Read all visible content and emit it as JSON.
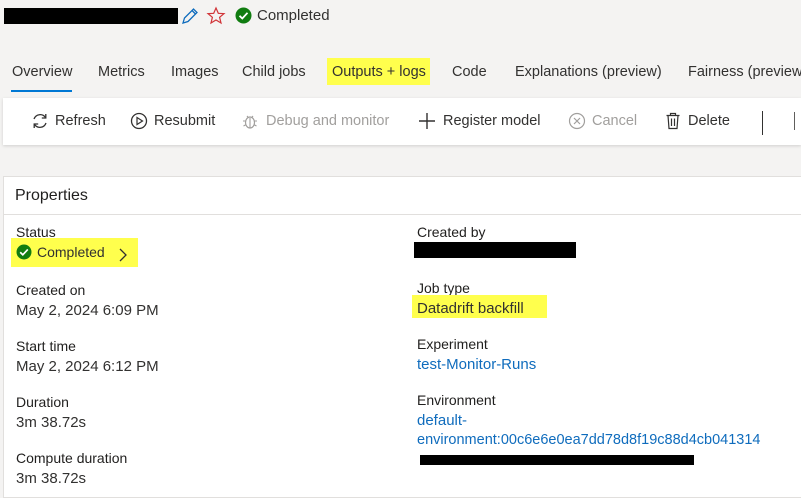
{
  "header": {
    "status_text": "Completed"
  },
  "tabs": [
    {
      "label": "Overview"
    },
    {
      "label": "Metrics"
    },
    {
      "label": "Images"
    },
    {
      "label": "Child jobs"
    },
    {
      "label": "Outputs + logs"
    },
    {
      "label": "Code"
    },
    {
      "label": "Explanations (preview)"
    },
    {
      "label": "Fairness (preview)"
    }
  ],
  "toolbar": {
    "refresh": "Refresh",
    "resubmit": "Resubmit",
    "debug": "Debug and monitor",
    "register": "Register model",
    "cancel": "Cancel",
    "delete": "Delete"
  },
  "properties": {
    "title": "Properties",
    "status_label": "Status",
    "status_value": "Completed",
    "created_on_label": "Created on",
    "created_on_value": "May 2, 2024 6:09 PM",
    "start_time_label": "Start time",
    "start_time_value": "May 2, 2024 6:12 PM",
    "duration_label": "Duration",
    "duration_value": "3m 38.72s",
    "compute_duration_label": "Compute duration",
    "compute_duration_value": "3m 38.72s",
    "created_by_label": "Created by",
    "job_type_label": "Job type",
    "job_type_value": "Datadrift backfill",
    "experiment_label": "Experiment",
    "experiment_value": "test-Monitor-Runs",
    "environment_label": "Environment",
    "environment_line1": "default-",
    "environment_line2": "environment:00c6e6e0ea7dd78d8f19c88d4cb041314"
  },
  "colors": {
    "accent": "#0078d4",
    "link": "#0f6cbd",
    "success": "#107c10",
    "highlight": "#ffff4d",
    "favorite": "#d13438"
  }
}
